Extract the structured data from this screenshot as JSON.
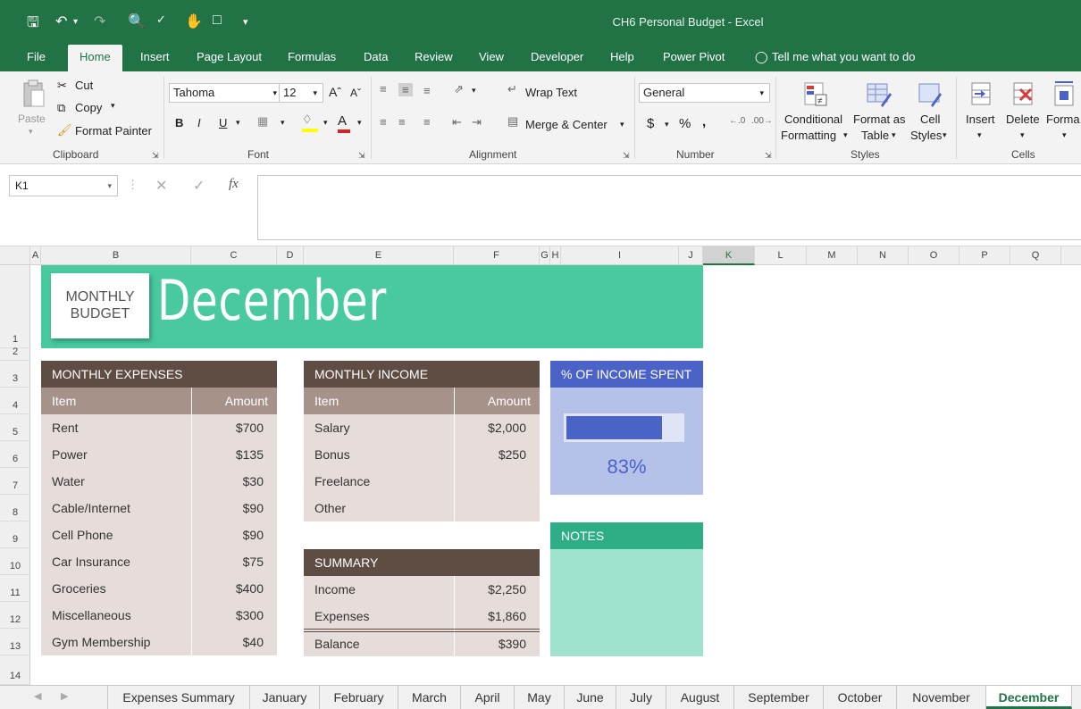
{
  "window": {
    "title": "CH6 Personal Budget  -  Excel"
  },
  "menu": {
    "tabs": [
      "File",
      "Home",
      "Insert",
      "Page Layout",
      "Formulas",
      "Data",
      "Review",
      "View",
      "Developer",
      "Help",
      "Power Pivot"
    ],
    "tell_me": "Tell me what you want to do"
  },
  "ribbon": {
    "clipboard": {
      "paste": "Paste",
      "cut": "Cut",
      "copy": "Copy",
      "format_painter": "Format Painter",
      "label": "Clipboard"
    },
    "font": {
      "name": "Tahoma",
      "size": "12",
      "bold": "B",
      "italic": "I",
      "underline": "U",
      "label": "Font"
    },
    "alignment": {
      "wrap": "Wrap Text",
      "merge": "Merge & Center",
      "label": "Alignment"
    },
    "number": {
      "format": "General",
      "currency": "$",
      "percent": "%",
      "comma": ",",
      "label": "Number"
    },
    "styles": {
      "conditional_1": "Conditional",
      "conditional_2": "Formatting",
      "format_table_1": "Format as",
      "format_table_2": "Table",
      "cell_styles_1": "Cell",
      "cell_styles_2": "Styles",
      "label": "Styles"
    },
    "cells": {
      "insert": "Insert",
      "delete": "Delete",
      "format": "Forma",
      "label": "Cells"
    }
  },
  "formula_bar": {
    "name_box": "K1",
    "content": ""
  },
  "columns": [
    "A",
    "B",
    "C",
    "D",
    "E",
    "F",
    "G",
    "H",
    "I",
    "J",
    "K",
    "L",
    "M",
    "N",
    "O",
    "P",
    "Q"
  ],
  "rows": [
    "1",
    "2",
    "3",
    "4",
    "5",
    "6",
    "7",
    "8",
    "9",
    "10",
    "11",
    "12",
    "13",
    "14"
  ],
  "sheet": {
    "sticky_1": "MONTHLY",
    "sticky_2": "BUDGET",
    "month_title": "December",
    "expenses": {
      "header": "MONTHLY EXPENSES",
      "col_item": "Item",
      "col_amount": "Amount",
      "rows": [
        {
          "item": "Rent",
          "amount": "$700"
        },
        {
          "item": "Power",
          "amount": "$135"
        },
        {
          "item": "Water",
          "amount": "$30"
        },
        {
          "item": "Cable/Internet",
          "amount": "$90"
        },
        {
          "item": "Cell Phone",
          "amount": "$90"
        },
        {
          "item": "Car Insurance",
          "amount": "$75"
        },
        {
          "item": "Groceries",
          "amount": "$400"
        },
        {
          "item": "Miscellaneous",
          "amount": "$300"
        },
        {
          "item": "Gym Membership",
          "amount": "$40"
        }
      ]
    },
    "income": {
      "header": "MONTHLY INCOME",
      "col_item": "Item",
      "col_amount": "Amount",
      "rows": [
        {
          "item": "Salary",
          "amount": "$2,000"
        },
        {
          "item": "Bonus",
          "amount": "$250"
        },
        {
          "item": "Freelance",
          "amount": ""
        },
        {
          "item": "Other",
          "amount": ""
        }
      ]
    },
    "summary": {
      "header": "SUMMARY",
      "rows": [
        {
          "item": "Income",
          "amount": "$2,250"
        },
        {
          "item": "Expenses",
          "amount": "$1,860"
        },
        {
          "item": "Balance",
          "amount": "$390"
        }
      ]
    },
    "percent_spent": {
      "header": "% OF INCOME SPENT",
      "value_text": "83%",
      "fraction": 0.83
    },
    "notes": {
      "header": "NOTES"
    }
  },
  "sheet_tabs": [
    "Expenses Summary",
    "January",
    "February",
    "March",
    "April",
    "May",
    "June",
    "July",
    "August",
    "September",
    "October",
    "November",
    "December"
  ],
  "active_sheet": "December",
  "colors": {
    "excel_green": "#217346",
    "banner": "#49c9a0",
    "table_header": "#5f4c43",
    "percent_blue": "#4b63c6",
    "notes_green": "#2dae87"
  }
}
